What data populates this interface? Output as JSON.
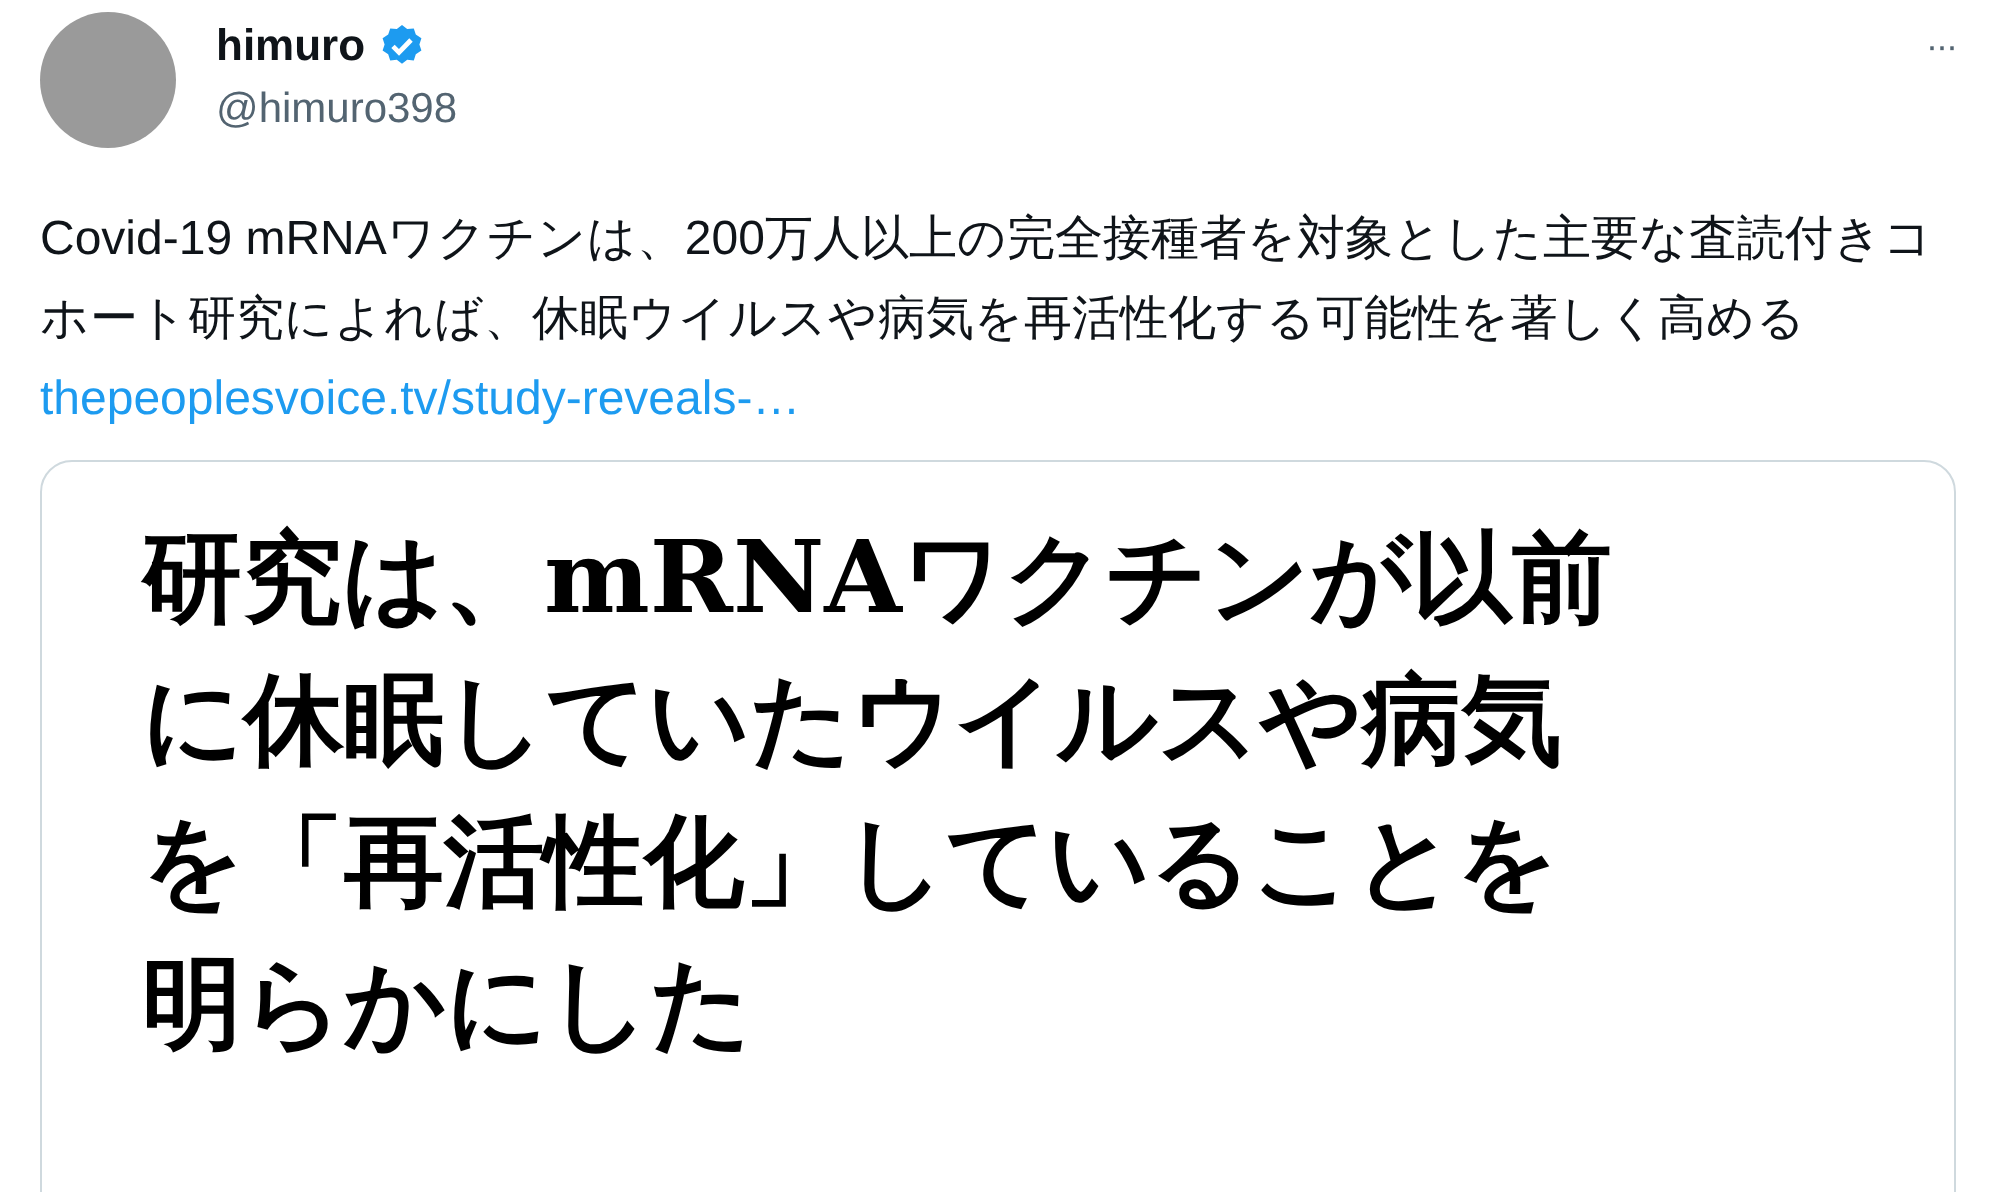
{
  "author": {
    "name": "himuro",
    "verified": true,
    "handle": "@himuro398"
  },
  "menu_icon": "···",
  "text": "Covid-19 mRNAワクチンは、200万人以上の完全接種者を対象とした主要な査読付きコホート研究によれば、休眠ウイルスや病気を再活性化する可能性を著しく高める",
  "link": "thepeoplesvoice.tv/study-reveals-…",
  "card": {
    "image_lines": [
      "研究は、mRNAワクチンが以前",
      "に休眠していたウイルスや病気",
      "を「再活性化」していることを",
      "明らかにした"
    ]
  }
}
